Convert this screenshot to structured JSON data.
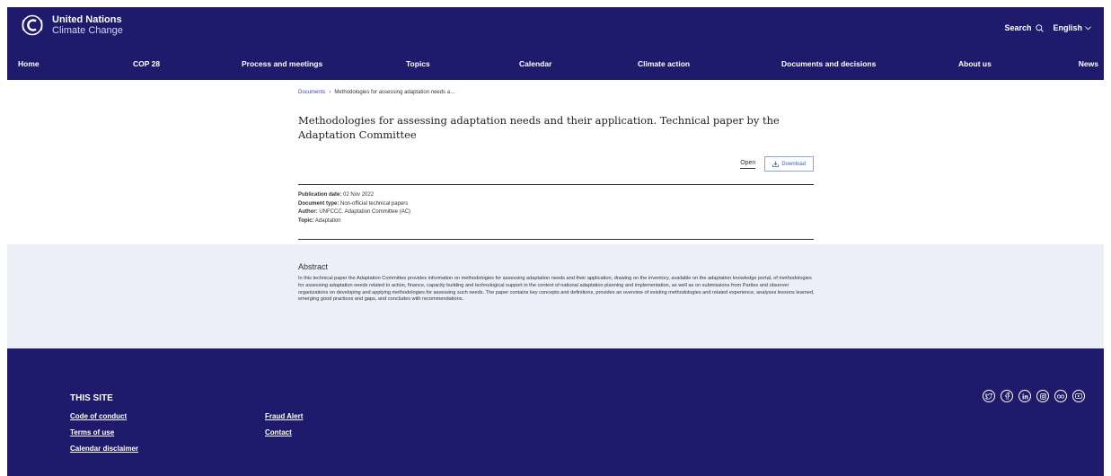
{
  "header": {
    "logo": {
      "line1": "United Nations",
      "line2": "Climate Change"
    },
    "search_label": "Search",
    "language": "English",
    "nav": [
      "Home",
      "COP 28",
      "Process and meetings",
      "Topics",
      "Calendar",
      "Climate action",
      "Documents and decisions",
      "About us",
      "News"
    ]
  },
  "breadcrumb": {
    "root": "Documents",
    "separator": "›",
    "current": "Methodologies for assessing adaptation needs a…"
  },
  "document": {
    "title": "Methodologies for assessing adaptation needs and their application. Technical paper by the Adaptation Committee",
    "open_label": "Open",
    "download_label": "Download",
    "meta": [
      {
        "label": "Publication date:",
        "value": "02 Nov 2022"
      },
      {
        "label": "Document type:",
        "value": "Non-official technical papers"
      },
      {
        "label": "Author:",
        "value": "UNFCCC. Adaptation Committee (AC)"
      },
      {
        "label": "Topic:",
        "value": "Adaptation"
      }
    ]
  },
  "abstract": {
    "heading": "Abstract",
    "text": "In this technical paper the Adaptation Committee provides information on methodologies for assessing adaptation needs and their application, drawing on the inventory, available on the adaptation knowledge portal, of methodologies for assessing adaptation needs related to action, finance, capacity building and technological support in the context of national adaptation planning and implementation, as well as on submissions from Parties and observer organizations on developing and applying methodologies for assessing such needs. The paper contains key concepts and definitions, provides an overview of existing methodologies and related experience, analyses lessons learned, emerging good practices and gaps, and concludes with recommendations."
  },
  "footer": {
    "heading": "THIS SITE",
    "links_col1": [
      "Code of conduct",
      "Terms of use",
      "Calendar disclaimer"
    ],
    "links_col2": [
      "Fraud Alert",
      "Contact"
    ],
    "social_icons": [
      "twitter-icon",
      "facebook-icon",
      "linkedin-icon",
      "instagram-icon",
      "flickr-icon",
      "youtube-icon"
    ]
  },
  "colors": {
    "brand_navy": "#1e1b6c",
    "abstract_band": "#eceef8",
    "link_blue": "#3d4ab5"
  }
}
